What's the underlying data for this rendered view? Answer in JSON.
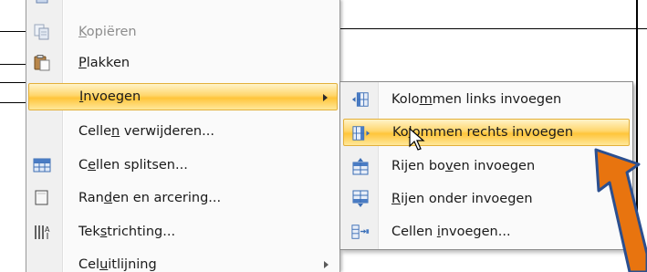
{
  "menu": {
    "items": [
      {
        "label_pre": "",
        "accel": "K",
        "label_post": "opiëren",
        "icon": "copy-icon",
        "disabled": true
      },
      {
        "label_pre": "",
        "accel": "P",
        "label_post": "lakken",
        "icon": "paste-icon",
        "disabled": false
      },
      {
        "label_pre": "",
        "accel": "I",
        "label_post": "nvoegen",
        "icon": "",
        "disabled": false,
        "highlighted": true,
        "submenu": true
      },
      {
        "label_pre": "Celle",
        "accel": "n",
        "label_post": " verwijderen...",
        "icon": "",
        "disabled": false
      },
      {
        "label_pre": "C",
        "accel": "e",
        "label_post": "llen splitsen...",
        "icon": "split-cells-icon",
        "disabled": false
      },
      {
        "label_pre": "Ran",
        "accel": "d",
        "label_post": "en en arcering...",
        "icon": "borders-shading-icon",
        "disabled": false
      },
      {
        "label_pre": "Tek",
        "accel": "s",
        "label_post": "trichting...",
        "icon": "text-direction-icon",
        "disabled": false
      },
      {
        "label_pre": "Cel",
        "accel": "u",
        "label_post": "itlijning",
        "icon": "",
        "disabled": false,
        "submenu": true
      }
    ]
  },
  "submenu": {
    "items": [
      {
        "label_pre": "Kolo",
        "accel": "m",
        "label_post": "men links invoegen",
        "icon": "insert-columns-left-icon"
      },
      {
        "label_pre": "Ko",
        "accel": "l",
        "label_post": "ommen rechts invoegen",
        "icon": "insert-columns-right-icon",
        "highlighted": true
      },
      {
        "label_pre": "Rijen bo",
        "accel": "v",
        "label_post": "en invoegen",
        "icon": "insert-rows-above-icon"
      },
      {
        "label_pre": "",
        "accel": "R",
        "label_post": "ijen onder invoegen",
        "icon": "insert-rows-below-icon"
      },
      {
        "label_pre": "Cellen ",
        "accel": "i",
        "label_post": "nvoegen...",
        "icon": "insert-cells-icon"
      }
    ]
  },
  "colors": {
    "highlight": "#ffd66b",
    "annotation_arrow": "#e8740f",
    "annotation_border": "#2b4f8f"
  }
}
